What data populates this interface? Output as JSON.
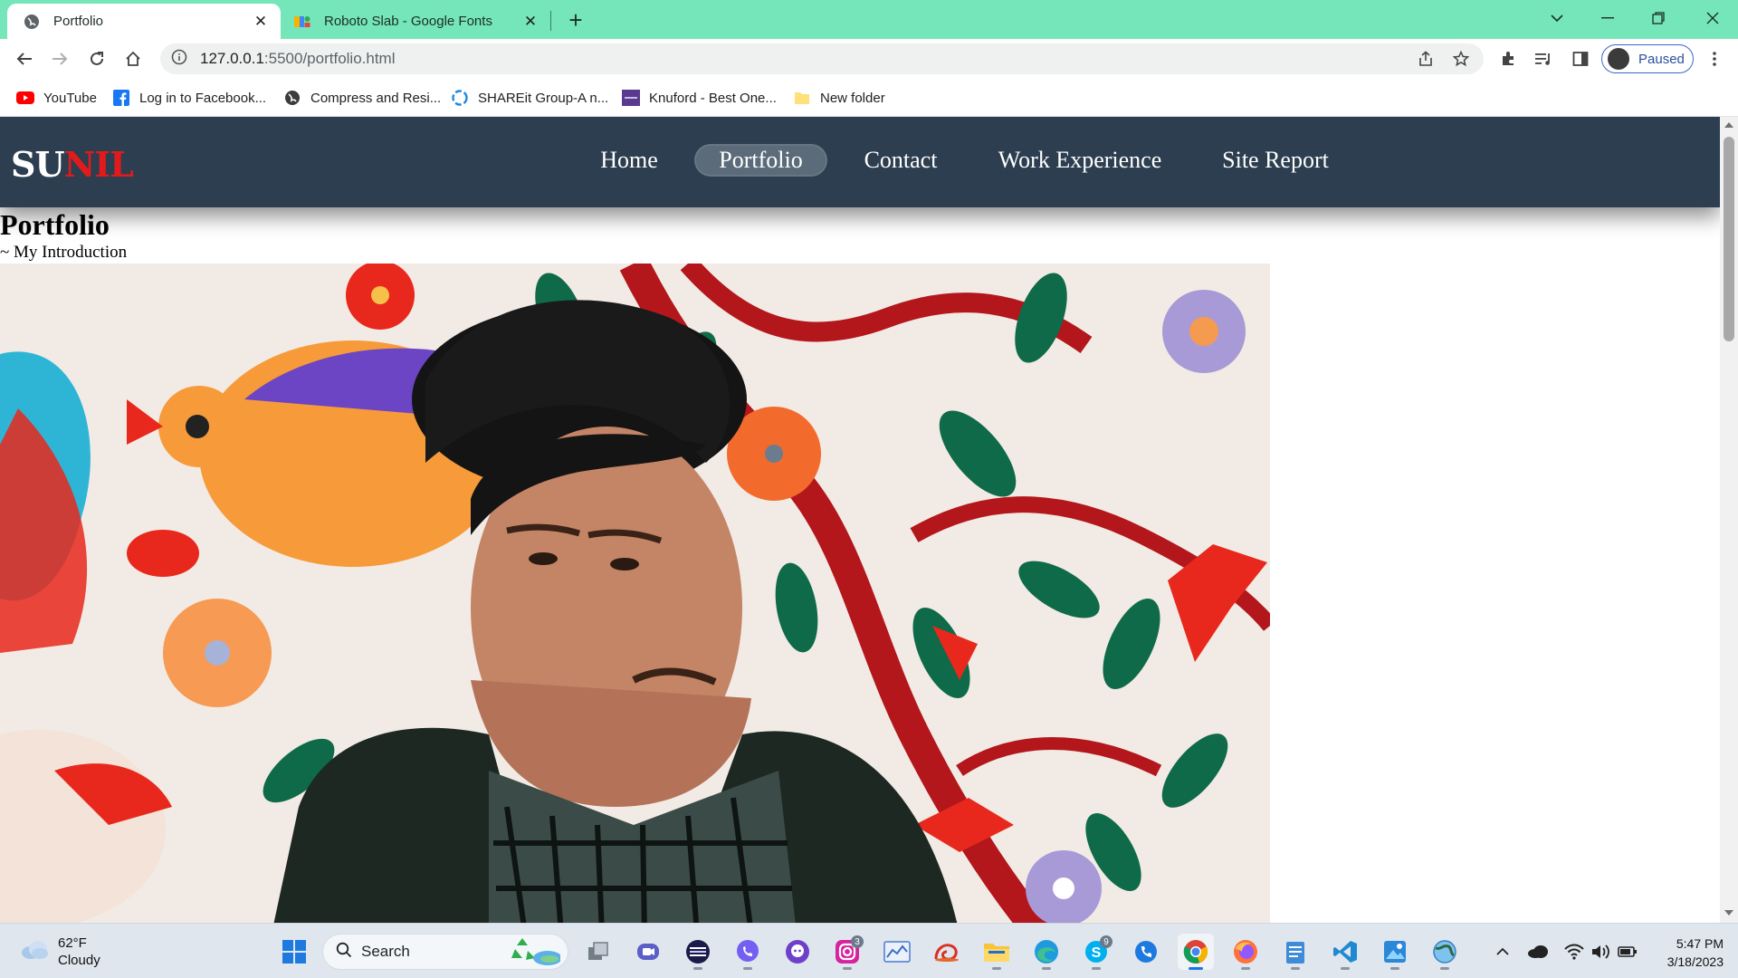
{
  "browser": {
    "tabs": [
      {
        "title": "Portfolio",
        "active": true,
        "icon": "globe-icon"
      },
      {
        "title": "Roboto Slab - Google Fonts",
        "active": false,
        "icon": "google-fonts-icon"
      }
    ],
    "address": {
      "host": "127.0.0.1",
      "path": ":5500/portfolio.html",
      "icon": "info-icon"
    },
    "profile_label": "Paused",
    "accent_color": "#74e6b9",
    "bookmarks": [
      {
        "label": "YouTube",
        "icon": "youtube-icon"
      },
      {
        "label": "Log in to Facebook...",
        "icon": "facebook-icon"
      },
      {
        "label": "Compress and Resi...",
        "icon": "globe-icon"
      },
      {
        "label": "SHAREit Group-A n...",
        "icon": "shareit-icon"
      },
      {
        "label": "Knuford - Best One...",
        "icon": "knuford-icon"
      },
      {
        "label": "New folder",
        "icon": "folder-icon"
      }
    ]
  },
  "site": {
    "logo": {
      "part1": "SU",
      "part2": "NIL"
    },
    "nav": [
      {
        "label": "Home",
        "active": false
      },
      {
        "label": "Portfolio",
        "active": true
      },
      {
        "label": "Contact",
        "active": false
      },
      {
        "label": "Work Experience",
        "active": false
      },
      {
        "label": "Site Report",
        "active": false
      }
    ],
    "nav_color": "#2c3e50",
    "logo_accent": "#e01b1b",
    "heading": "Portfolio",
    "subheading": "~ My Introduction"
  },
  "taskbar": {
    "weather": {
      "temp": "62°F",
      "condition": "Cloudy"
    },
    "search_label": "Search",
    "instagram_badge": "3",
    "skype_badge": "9",
    "time": "5:47 PM",
    "date": "3/18/2023"
  }
}
